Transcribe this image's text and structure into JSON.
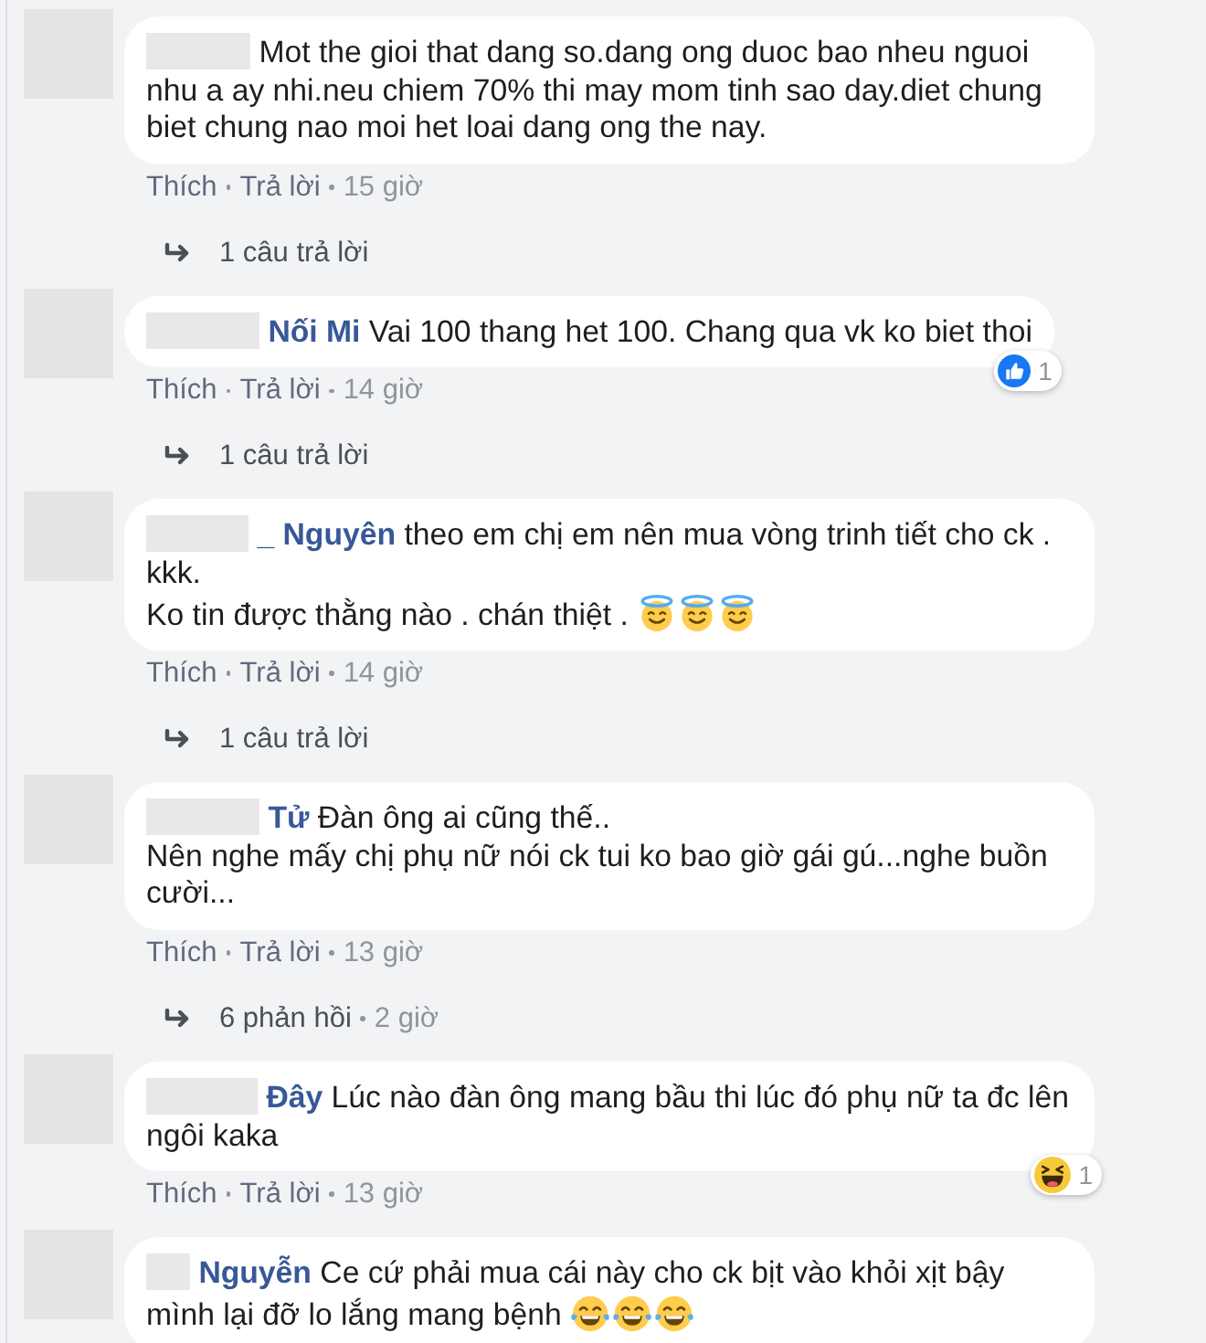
{
  "comments": [
    {
      "text": "Mot the gioi that dang so.dang ong duoc bao nheu nguoi nhu a ay nhi.neu chiem 70% thi may mom tinh sao day.diet chung biet chung nao moi het loai dang ong the nay.",
      "actions": [
        "Thích",
        "Trả lời"
      ],
      "time": "15 giờ",
      "replies": {
        "label": "1 câu trả lời"
      }
    },
    {
      "name": "Nối Mi",
      "text": "Vai 100 thang het 100. Chang qua vk ko biet thoi",
      "reaction": {
        "kind": "like",
        "count": "1"
      },
      "actions": [
        "Thích",
        "Trả lời"
      ],
      "time": "14 giờ",
      "replies": {
        "label": "1 câu trả lời"
      }
    },
    {
      "name": "_ Nguyên",
      "text": "theo em chị em nên mua vòng trinh tiết cho ck . kkk.\nKo tin được thằng nào . chán thiệt .",
      "emojis": [
        {
          "kind": "halo"
        },
        {
          "kind": "halo"
        },
        {
          "kind": "halo"
        }
      ],
      "actions": [
        "Thích",
        "Trả lời"
      ],
      "time": "14 giờ",
      "replies": {
        "label": "1 câu trả lời"
      }
    },
    {
      "name": "Tử",
      "text": "Đàn ông ai cũng thế..\nNên nghe mấy chị phụ nữ nói ck tui ko bao giờ gái gú...nghe buồn cười...",
      "actions": [
        "Thích",
        "Trả lời"
      ],
      "time": "13 giờ",
      "replies": {
        "label": "6 phản hồi",
        "time": "2 giờ"
      }
    },
    {
      "name": "Đây",
      "text": "Lúc nào đàn ông mang bầu thi lúc đó phụ nữ ta đc lên ngôi kaka",
      "reaction": {
        "kind": "haha",
        "count": "1"
      },
      "actions": [
        "Thích",
        "Trả lời"
      ],
      "time": "13 giờ"
    },
    {
      "name": "Nguyễn",
      "text": "Ce cứ phải mua cái này cho ck bịt vào khỏi xịt bậy mình lại đỡ lo lắng mang bệnh",
      "emojis": [
        {
          "kind": "tears_of_joy"
        },
        {
          "kind": "tears_of_joy"
        },
        {
          "kind": "tears_of_joy"
        }
      ]
    }
  ]
}
